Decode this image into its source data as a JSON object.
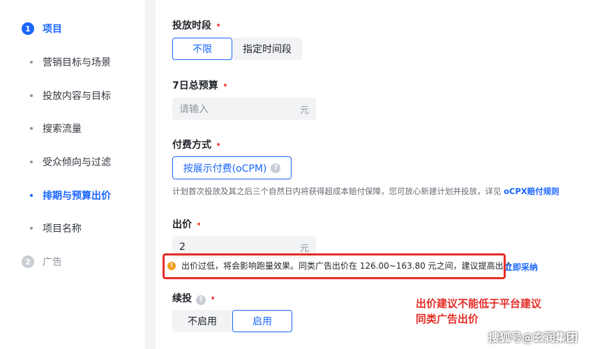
{
  "sidebar": {
    "steps": [
      {
        "num": "1",
        "label": "项目"
      },
      {
        "num": "2",
        "label": "广告"
      }
    ],
    "items": [
      {
        "label": "营销目标与场景"
      },
      {
        "label": "投放内容与目标"
      },
      {
        "label": "搜索流量"
      },
      {
        "label": "受众倾向与过滤"
      },
      {
        "label": "排期与预算出价"
      },
      {
        "label": "项目名称"
      }
    ],
    "active_item": "排期与预算出价"
  },
  "schedule": {
    "label": "投放时段",
    "required": "•",
    "options": [
      "不限",
      "指定时间段"
    ],
    "selected": "不限"
  },
  "budget": {
    "label": "7日总预算",
    "required": "•",
    "placeholder": "请输入",
    "unit": "元"
  },
  "payment": {
    "label": "付费方式",
    "required": "•",
    "button_label": "按展示付费(oCPM)",
    "help_icon": "?",
    "hint": "计划首次投放及其之后三个自然日内将获得超成本赔付保障，您可放心新建计划并投放，详见",
    "hint_link": "oCPX赔付规则"
  },
  "bid": {
    "label": "出价",
    "required": "•",
    "value": "2",
    "unit": "元",
    "warning_icon": "!",
    "warning": "出价过低，将会影响跑量效果。同类广告出价在 126.00~163.80 元之间，建议提高出价",
    "adopt_link": "立即采纳"
  },
  "renew": {
    "label": "续投",
    "help_icon": "?",
    "required": "•",
    "options": [
      "不启用",
      "启用"
    ],
    "selected": "启用"
  },
  "annotation": {
    "line1": "出价建议不能低于平台建议",
    "line2": "同类广告出价"
  },
  "watermark": "搜狐号@玄润集团",
  "colors": {
    "accent": "#1a66ff",
    "required": "#f54a45",
    "warning": "#f0a020",
    "annotation_red": "#e52d27"
  }
}
